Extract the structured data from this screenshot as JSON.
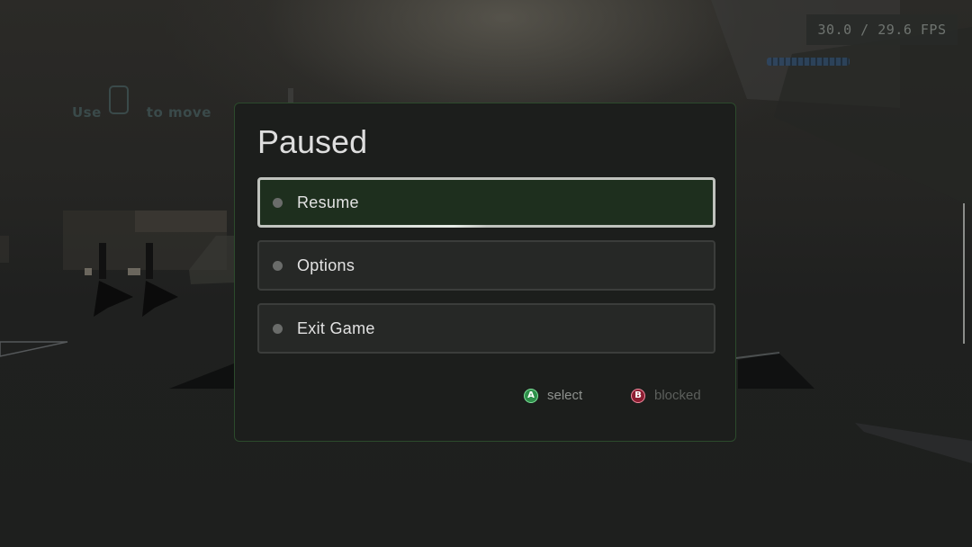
{
  "hud": {
    "fps": "30.0 / 29.6 FPS",
    "hint_prefix": "Use",
    "hint_suffix": "to move"
  },
  "pause_menu": {
    "title": "Paused",
    "items": [
      {
        "label": "Resume",
        "selected": true,
        "hold_progress": 0.5
      },
      {
        "label": "Options",
        "selected": false
      },
      {
        "label": "Exit Game",
        "selected": false
      }
    ],
    "controls": [
      {
        "glyph": "A",
        "label": "select",
        "color": "#2e8f4a"
      },
      {
        "glyph": "B",
        "label": "blocked",
        "color": "#8c1e32"
      }
    ]
  },
  "colors": {
    "accent_green": "#2c4a2c",
    "selected_bg": "#1e2f1e"
  }
}
